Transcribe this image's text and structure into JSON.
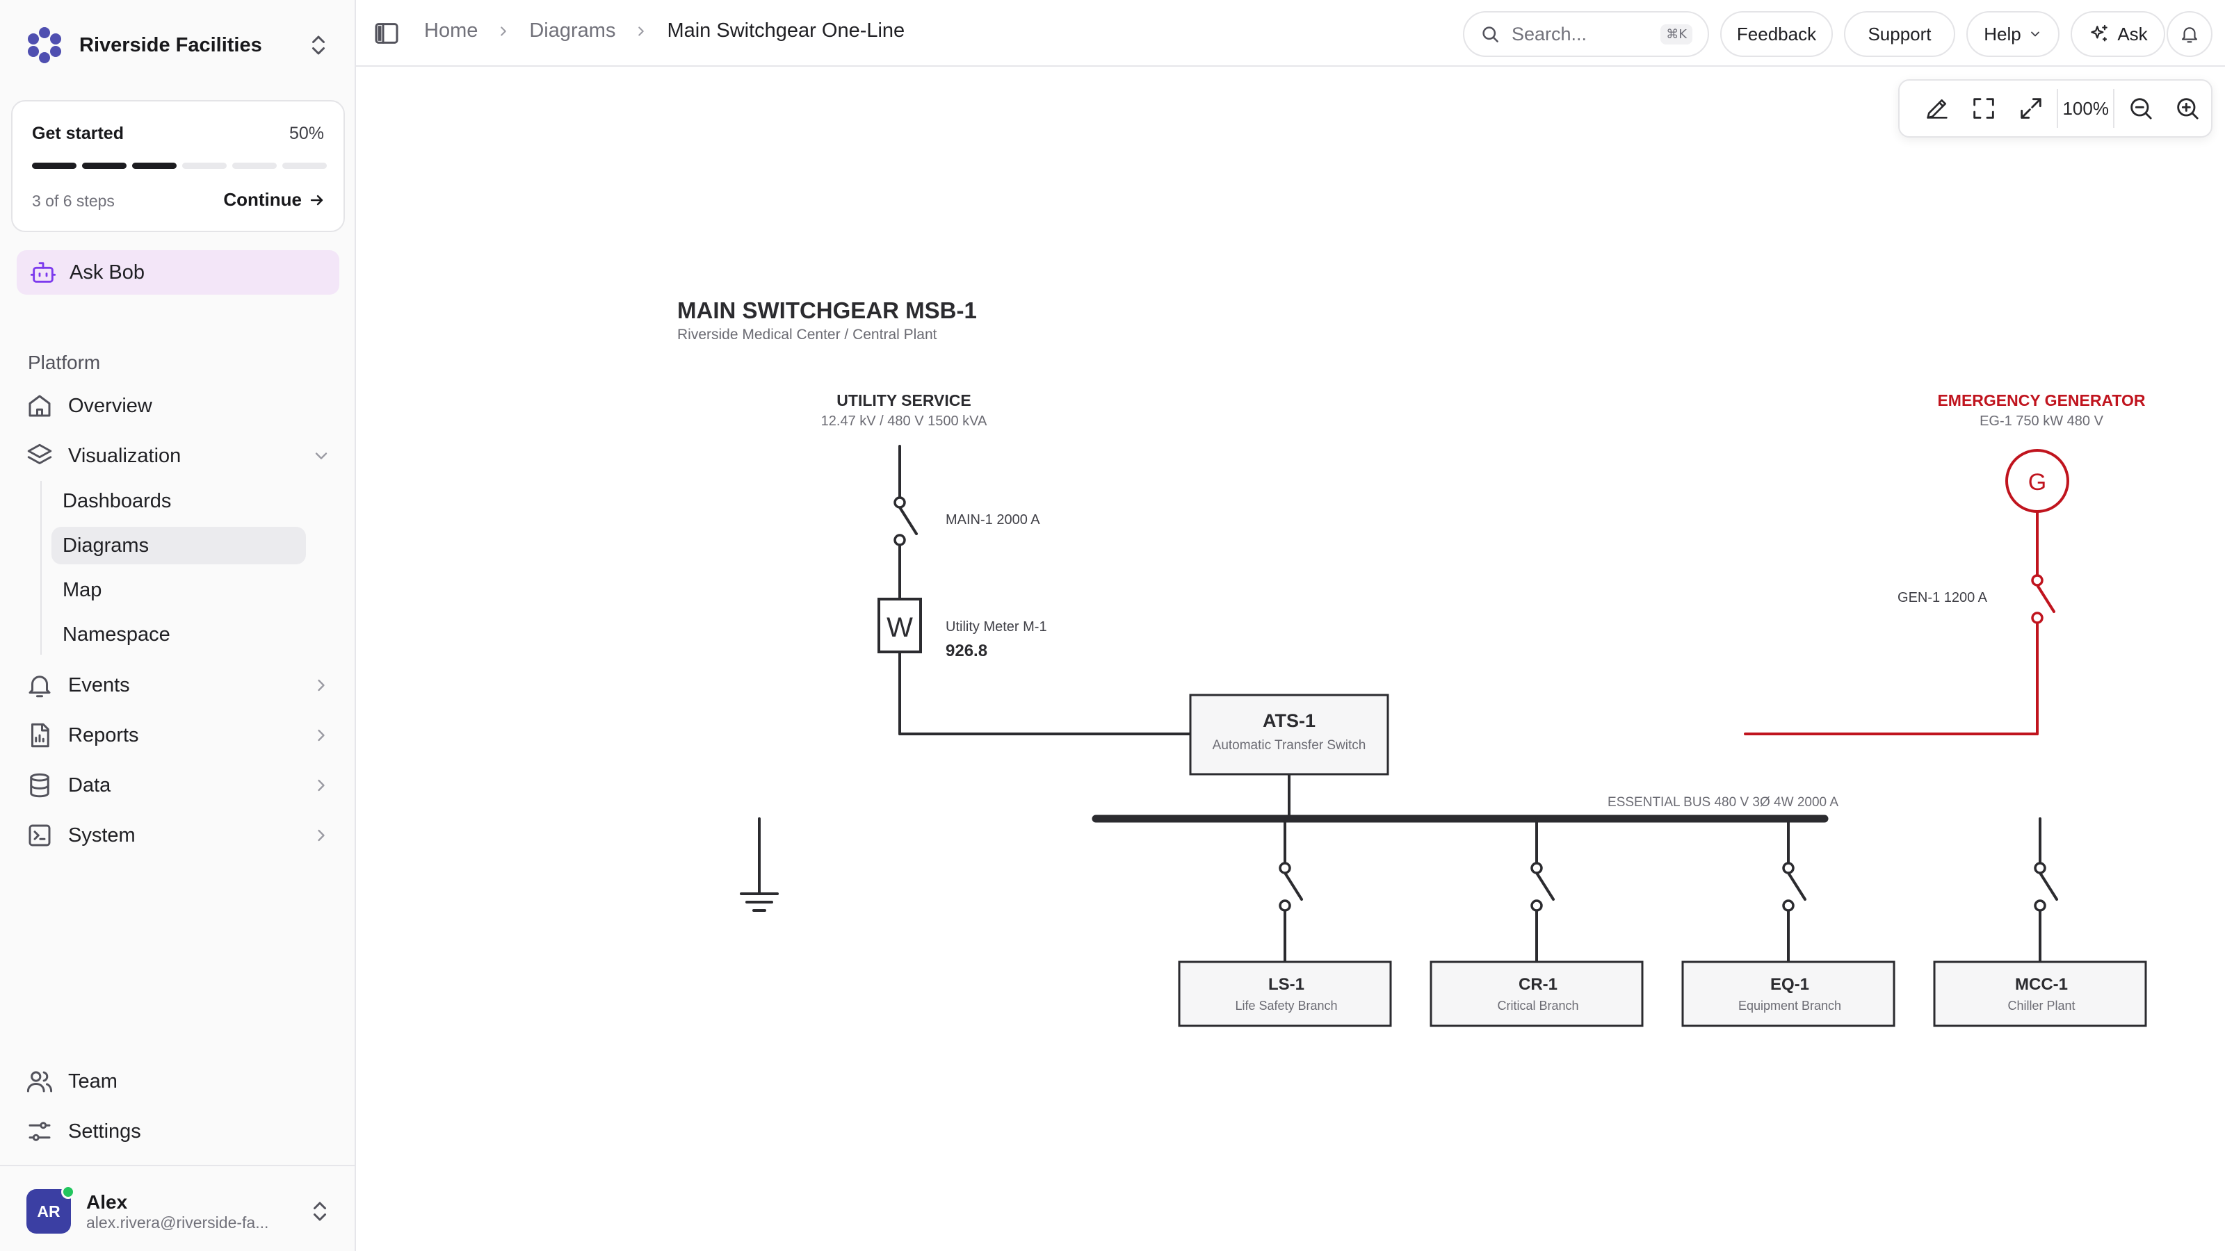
{
  "sidebar": {
    "org_name": "Riverside Facilities",
    "get_started": {
      "title": "Get started",
      "percent": "50%",
      "steps_done": 3,
      "steps_total": 6,
      "steps_text": "3 of 6 steps",
      "continue_label": "Continue"
    },
    "ask_bob": "Ask Bob",
    "section": "Platform",
    "nav": {
      "overview": "Overview",
      "visualization": "Visualization",
      "dashboards": "Dashboards",
      "diagrams": "Diagrams",
      "map": "Map",
      "namespace": "Namespace",
      "events": "Events",
      "reports": "Reports",
      "data": "Data",
      "system": "System",
      "team": "Team",
      "settings": "Settings"
    },
    "user": {
      "initials": "AR",
      "name": "Alex",
      "email": "alex.rivera@riverside-fa..."
    }
  },
  "topbar": {
    "breadcrumb": [
      "Home",
      "Diagrams",
      "Main Switchgear One-Line"
    ],
    "search_placeholder": "Search...",
    "search_shortcut": "⌘K",
    "feedback": "Feedback",
    "support": "Support",
    "help": "Help",
    "ask": "Ask"
  },
  "zoom": {
    "level": "100%"
  },
  "diagram": {
    "title": "MAIN SWITCHGEAR MSB-1",
    "subtitle": "Riverside Medical Center / Central Plant",
    "utility": {
      "label": "UTILITY SERVICE",
      "spec": "12.47 kV / 480 V  1500 kVA"
    },
    "main_breaker": "MAIN-1   2000 A",
    "meter": {
      "symbol": "W",
      "label": "Utility Meter M-1",
      "value": "926.8"
    },
    "generator": {
      "label": "EMERGENCY GENERATOR",
      "spec": "EG-1   750 kW   480 V",
      "symbol": "G"
    },
    "gen_breaker": "GEN-1   1200 A",
    "ats": {
      "name": "ATS-1",
      "desc": "Automatic Transfer Switch"
    },
    "bus_label": "ESSENTIAL BUS   480 V   3Ø 4W    2000 A",
    "branches": [
      {
        "name": "LS-1",
        "desc": "Life Safety Branch"
      },
      {
        "name": "CR-1",
        "desc": "Critical Branch"
      },
      {
        "name": "EQ-1",
        "desc": "Equipment Branch"
      },
      {
        "name": "MCC-1",
        "desc": "Chiller Plant"
      }
    ],
    "colors": {
      "line": "#2b2b2f",
      "emergency": "#c0141e"
    }
  }
}
